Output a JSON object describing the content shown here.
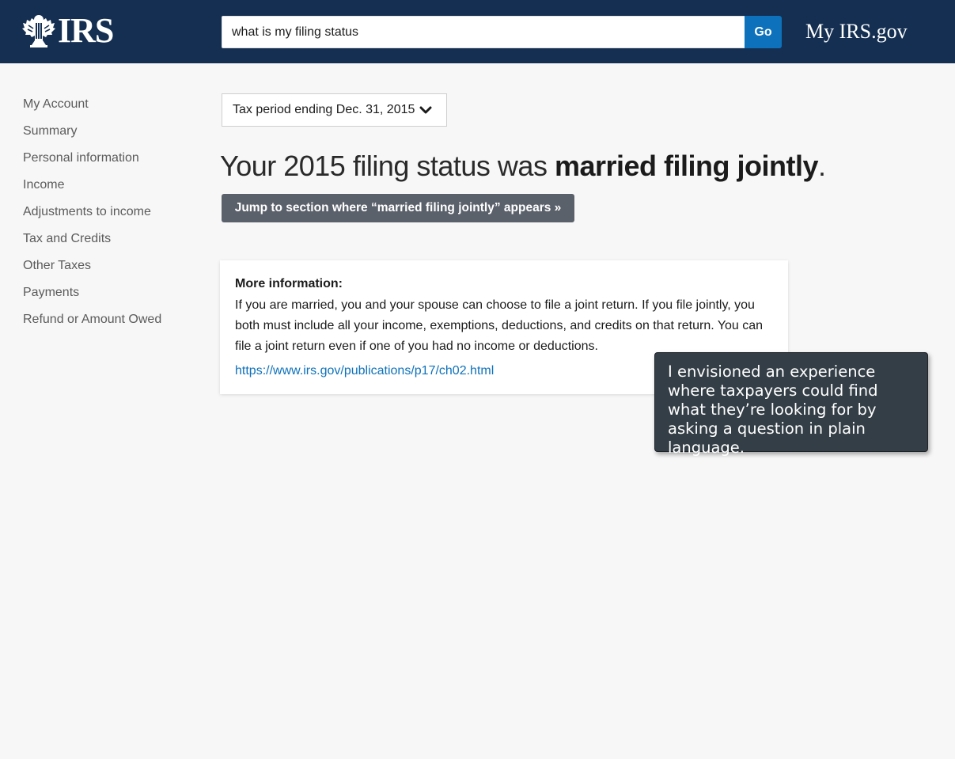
{
  "header": {
    "logo_text": "IRS",
    "search": {
      "value": "what is my filing status",
      "placeholder": ""
    },
    "go_label": "Go",
    "myirs_label": "My IRS.gov"
  },
  "sidebar": {
    "items": [
      {
        "label": "My Account"
      },
      {
        "label": "Summary"
      },
      {
        "label": "Personal information"
      },
      {
        "label": "Income"
      },
      {
        "label": "Adjustments to income"
      },
      {
        "label": "Tax and Credits"
      },
      {
        "label": "Other Taxes"
      },
      {
        "label": "Payments"
      },
      {
        "label": "Refund or Amount Owed"
      }
    ]
  },
  "main": {
    "period_select": {
      "selected": "Tax period ending Dec. 31, 2015"
    },
    "headline": {
      "prefix": "Your 2015 filing status was ",
      "status": "married filing jointly",
      "suffix": "."
    },
    "jump_button_label": "Jump to section where “married filing jointly” appears »",
    "info": {
      "title": "More information:",
      "body": "If you are married, you and your spouse can choose to file a joint return. If you file jointly, you both must include all your income, exemptions, deductions, and credits on that return. You can file a joint return even if one of you had no income or deductions.",
      "link": "https://www.irs.gov/publications/p17/ch02.html"
    }
  },
  "annotation": {
    "text": "I envisioned an experience where taxpayers could find what they’re looking for by asking a question in plain language."
  },
  "colors": {
    "header_bg": "#142f52",
    "accent": "#0e71bb",
    "button_gray": "#5b616b",
    "page_bg": "#f7f7f7",
    "annotation_bg": "#343e46"
  },
  "icons": {
    "logo": "irs-eagle-icon",
    "dropdown": "chevron-down-icon"
  }
}
